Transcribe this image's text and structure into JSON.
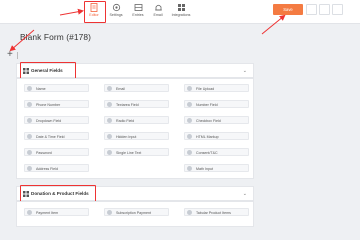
{
  "toolbar": {
    "tabs": [
      {
        "label": "Editor",
        "icon": "form-icon",
        "active": true
      },
      {
        "label": "Settings",
        "icon": "gear-icon",
        "active": false
      },
      {
        "label": "Entries",
        "icon": "entries-icon",
        "active": false
      },
      {
        "label": "Email",
        "icon": "bell-icon",
        "active": false
      },
      {
        "label": "Integrations",
        "icon": "integrations-icon",
        "active": false
      }
    ],
    "save_label": "Save"
  },
  "form": {
    "title": "Blank Form (#178)"
  },
  "builder": {
    "add_symbol": "+"
  },
  "sections": {
    "general": {
      "title": "General Fields",
      "fields": [
        [
          "Name",
          "Email",
          "File Upload"
        ],
        [
          "Phone Number",
          "Textarea Field",
          "Number Field"
        ],
        [
          "Dropdown Field",
          "Radio Field",
          "Checkbox Field"
        ],
        [
          "Date & Time Field",
          "Hidden Input",
          "HTML Markup"
        ],
        [
          "Password",
          "Single Line Text",
          "Consent/T&C"
        ],
        [
          "Address Field",
          "",
          "Math Input"
        ]
      ]
    },
    "donation": {
      "title": "Donation & Product Fields",
      "fields": [
        [
          "Payment Item",
          "Subscription Payment",
          "Tabular Product Items"
        ]
      ]
    }
  },
  "colors": {
    "accent": "#f47b42",
    "annotation": "#e33333"
  }
}
